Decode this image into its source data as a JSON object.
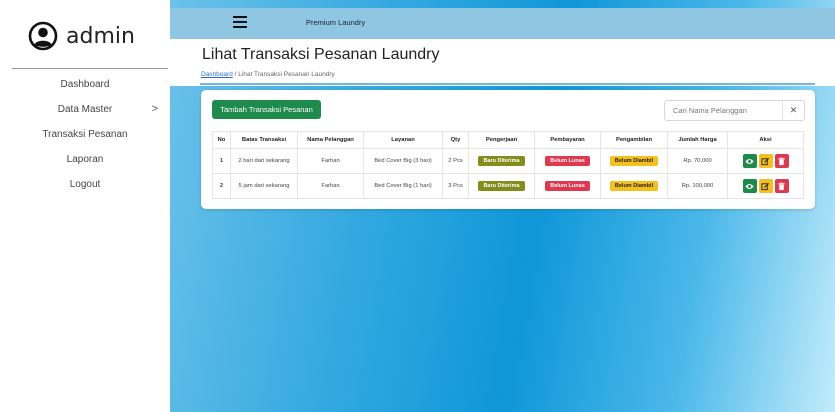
{
  "sidebar": {
    "brand": "admin",
    "items": [
      {
        "label": "Dashboard",
        "has_chevron": false
      },
      {
        "label": "Data Master",
        "has_chevron": true,
        "chevron": ">"
      },
      {
        "label": "Transaksi Pesanan",
        "has_chevron": false
      },
      {
        "label": "Laporan",
        "has_chevron": false
      },
      {
        "label": "Logout",
        "has_chevron": false
      }
    ]
  },
  "topbar": {
    "app_name": "Premium Laundry",
    "menu_icon": "hamburger-icon"
  },
  "header": {
    "title": "Lihat Transaksi Pesanan Laundry",
    "breadcrumb_link": "Dashboard",
    "breadcrumb_sep": "/",
    "breadcrumb_current": "Lihat Transaksi Pesanan Laundry"
  },
  "card": {
    "add_button": "Tambah Transaksi Pesanan",
    "search_placeholder": "Cari Nama Pelanggan",
    "clear_glyph": "✕",
    "columns": [
      "No",
      "Batas Transaksi",
      "Nama Pelanggan",
      "Layanan",
      "Qty",
      "Pengerjaan",
      "Pembayaran",
      "Pengambilan",
      "Jumlah Harga",
      "Aksi"
    ],
    "rows": [
      {
        "no": "1",
        "batas": "2 hari dari sekarang",
        "nama": "Farhan",
        "layanan": "Bed Cover Big (3 hari)",
        "qty": "2 Pcs",
        "pengerjaan": "Baru Diterima",
        "pembayaran": "Belum Lunas",
        "pengambilan": "Belum Diambil",
        "harga": "Rp. 70,000"
      },
      {
        "no": "2",
        "batas": "5 jam dari sekarang",
        "nama": "Farhan",
        "layanan": "Bed Cover Big (1 hari)",
        "qty": "3 Pcs",
        "pengerjaan": "Baru Diterima",
        "pembayaran": "Belum Lunas",
        "pengambilan": "Belum Diambil",
        "harga": "Rp. 100,000"
      }
    ]
  },
  "colors": {
    "green": "#1e8a4c",
    "olive": "#848c1c",
    "red": "#e0384f",
    "yellow": "#f4c01b",
    "topbar": "#8fc7e3"
  }
}
